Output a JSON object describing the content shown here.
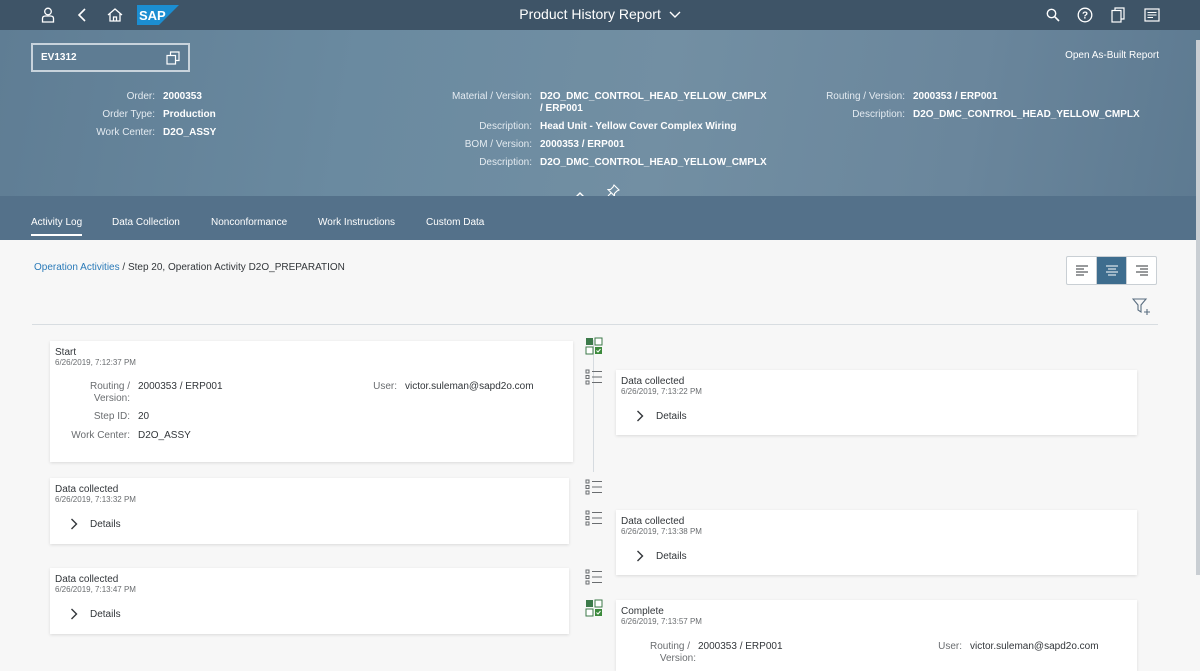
{
  "shell": {
    "title": "Product History Report",
    "logo_text": "SAP",
    "icons": [
      "user-icon",
      "back-icon",
      "home-icon",
      "search-icon",
      "help-icon",
      "copy-icon",
      "notifications-icon"
    ]
  },
  "header": {
    "sfc_value": "EV1312",
    "open_as_built": "Open As-Built Report",
    "col1": [
      {
        "label": "Order:",
        "value": "2000353"
      },
      {
        "label": "Order Type:",
        "value": "Production"
      },
      {
        "label": "Work Center:",
        "value": "D2O_ASSY"
      }
    ],
    "col2": [
      {
        "label": "Material / Version:",
        "value": "D2O_DMC_CONTROL_HEAD_YELLOW_CMPLX",
        "value2": "/ ERP001"
      },
      {
        "label": "Description:",
        "value": "Head Unit - Yellow Cover Complex Wiring"
      },
      {
        "label": "BOM / Version:",
        "value": "2000353 / ERP001"
      },
      {
        "label": "Description:",
        "value": "D2O_DMC_CONTROL_HEAD_YELLOW_CMPLX"
      }
    ],
    "col3": [
      {
        "label": "Routing / Version:",
        "value": "2000353 / ERP001"
      },
      {
        "label": "Description:",
        "value": "D2O_DMC_CONTROL_HEAD_YELLOW_CMPLX"
      }
    ]
  },
  "tabs": [
    "Activity Log",
    "Data Collection",
    "Nonconformance",
    "Work Instructions",
    "Custom Data"
  ],
  "active_tab": "Activity Log",
  "breadcrumb": {
    "link": "Operation Activities",
    "rest": " / Step 20, Operation Activity D2O_PREPARATION"
  },
  "cards": {
    "start": {
      "title": "Start",
      "date": "6/26/2019, 7:12:37 PM",
      "routing_label": "Routing /",
      "routing_label2": "Version:",
      "routing_value": "2000353 / ERP001",
      "step_label": "Step ID:",
      "step_value": "20",
      "wc_label": "Work Center:",
      "wc_value": "D2O_ASSY",
      "user_label": "User:",
      "user_value": "victor.suleman@sapd2o.com"
    },
    "dc1": {
      "title": "Data collected",
      "date": "6/26/2019, 7:13:22 PM",
      "details": "Details"
    },
    "dc2": {
      "title": "Data collected",
      "date": "6/26/2019, 7:13:32 PM",
      "details": "Details"
    },
    "dc3": {
      "title": "Data collected",
      "date": "6/26/2019, 7:13:38 PM",
      "details": "Details"
    },
    "dc4": {
      "title": "Data collected",
      "date": "6/26/2019, 7:13:47 PM",
      "details": "Details"
    },
    "complete": {
      "title": "Complete",
      "date": "6/26/2019, 7:13:57 PM",
      "routing_label": "Routing /",
      "routing_label2": "Version:",
      "routing_value": "2000353 / ERP001",
      "user_label": "User:",
      "user_value": "victor.suleman@sapd2o.com"
    }
  },
  "colors": {
    "shell": "#3e5467",
    "header": "#6a879c",
    "accent": "#2a7ab8",
    "activity_green": "#3c8a3c"
  }
}
